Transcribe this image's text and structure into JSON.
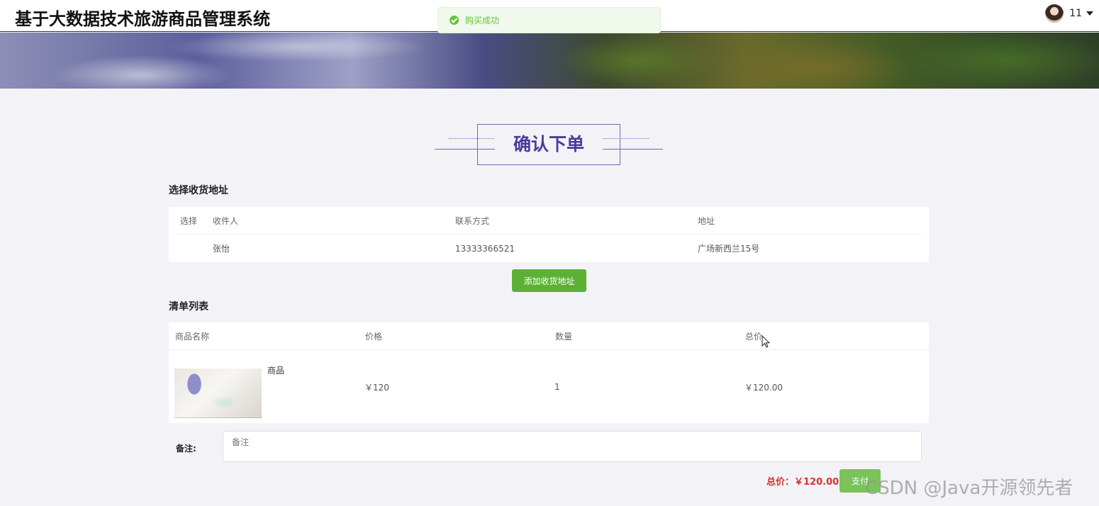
{
  "header": {
    "site_title": "基于大数据技术旅游商品管理系统",
    "username": "11"
  },
  "toast": {
    "message": "购买成功"
  },
  "page": {
    "title": "确认下单"
  },
  "address_section": {
    "label": "选择收货地址",
    "columns": [
      "选择",
      "收件人",
      "联系方式",
      "地址"
    ],
    "rows": [
      {
        "selected": true,
        "recipient": "张怡",
        "phone": "13333366521",
        "address": "广场新西兰15号"
      }
    ],
    "add_button": "添加收货地址"
  },
  "order_section": {
    "label": "清单列表",
    "columns": [
      "商品名称",
      "价格",
      "数量",
      "总价"
    ],
    "rows": [
      {
        "name": "商品",
        "price": "￥120",
        "quantity": "1",
        "total": "￥120.00"
      }
    ]
  },
  "remark": {
    "label": "备注:",
    "placeholder": "备注"
  },
  "checkout": {
    "total_text": "总价：￥120.00",
    "pay_button": "支付"
  },
  "watermark": "CSDN @Java开源领先者",
  "colors": {
    "accent_purple": "#4a3c9a",
    "success_green": "#67c23a",
    "button_green": "#5cb135",
    "price_red": "#d9322e"
  }
}
